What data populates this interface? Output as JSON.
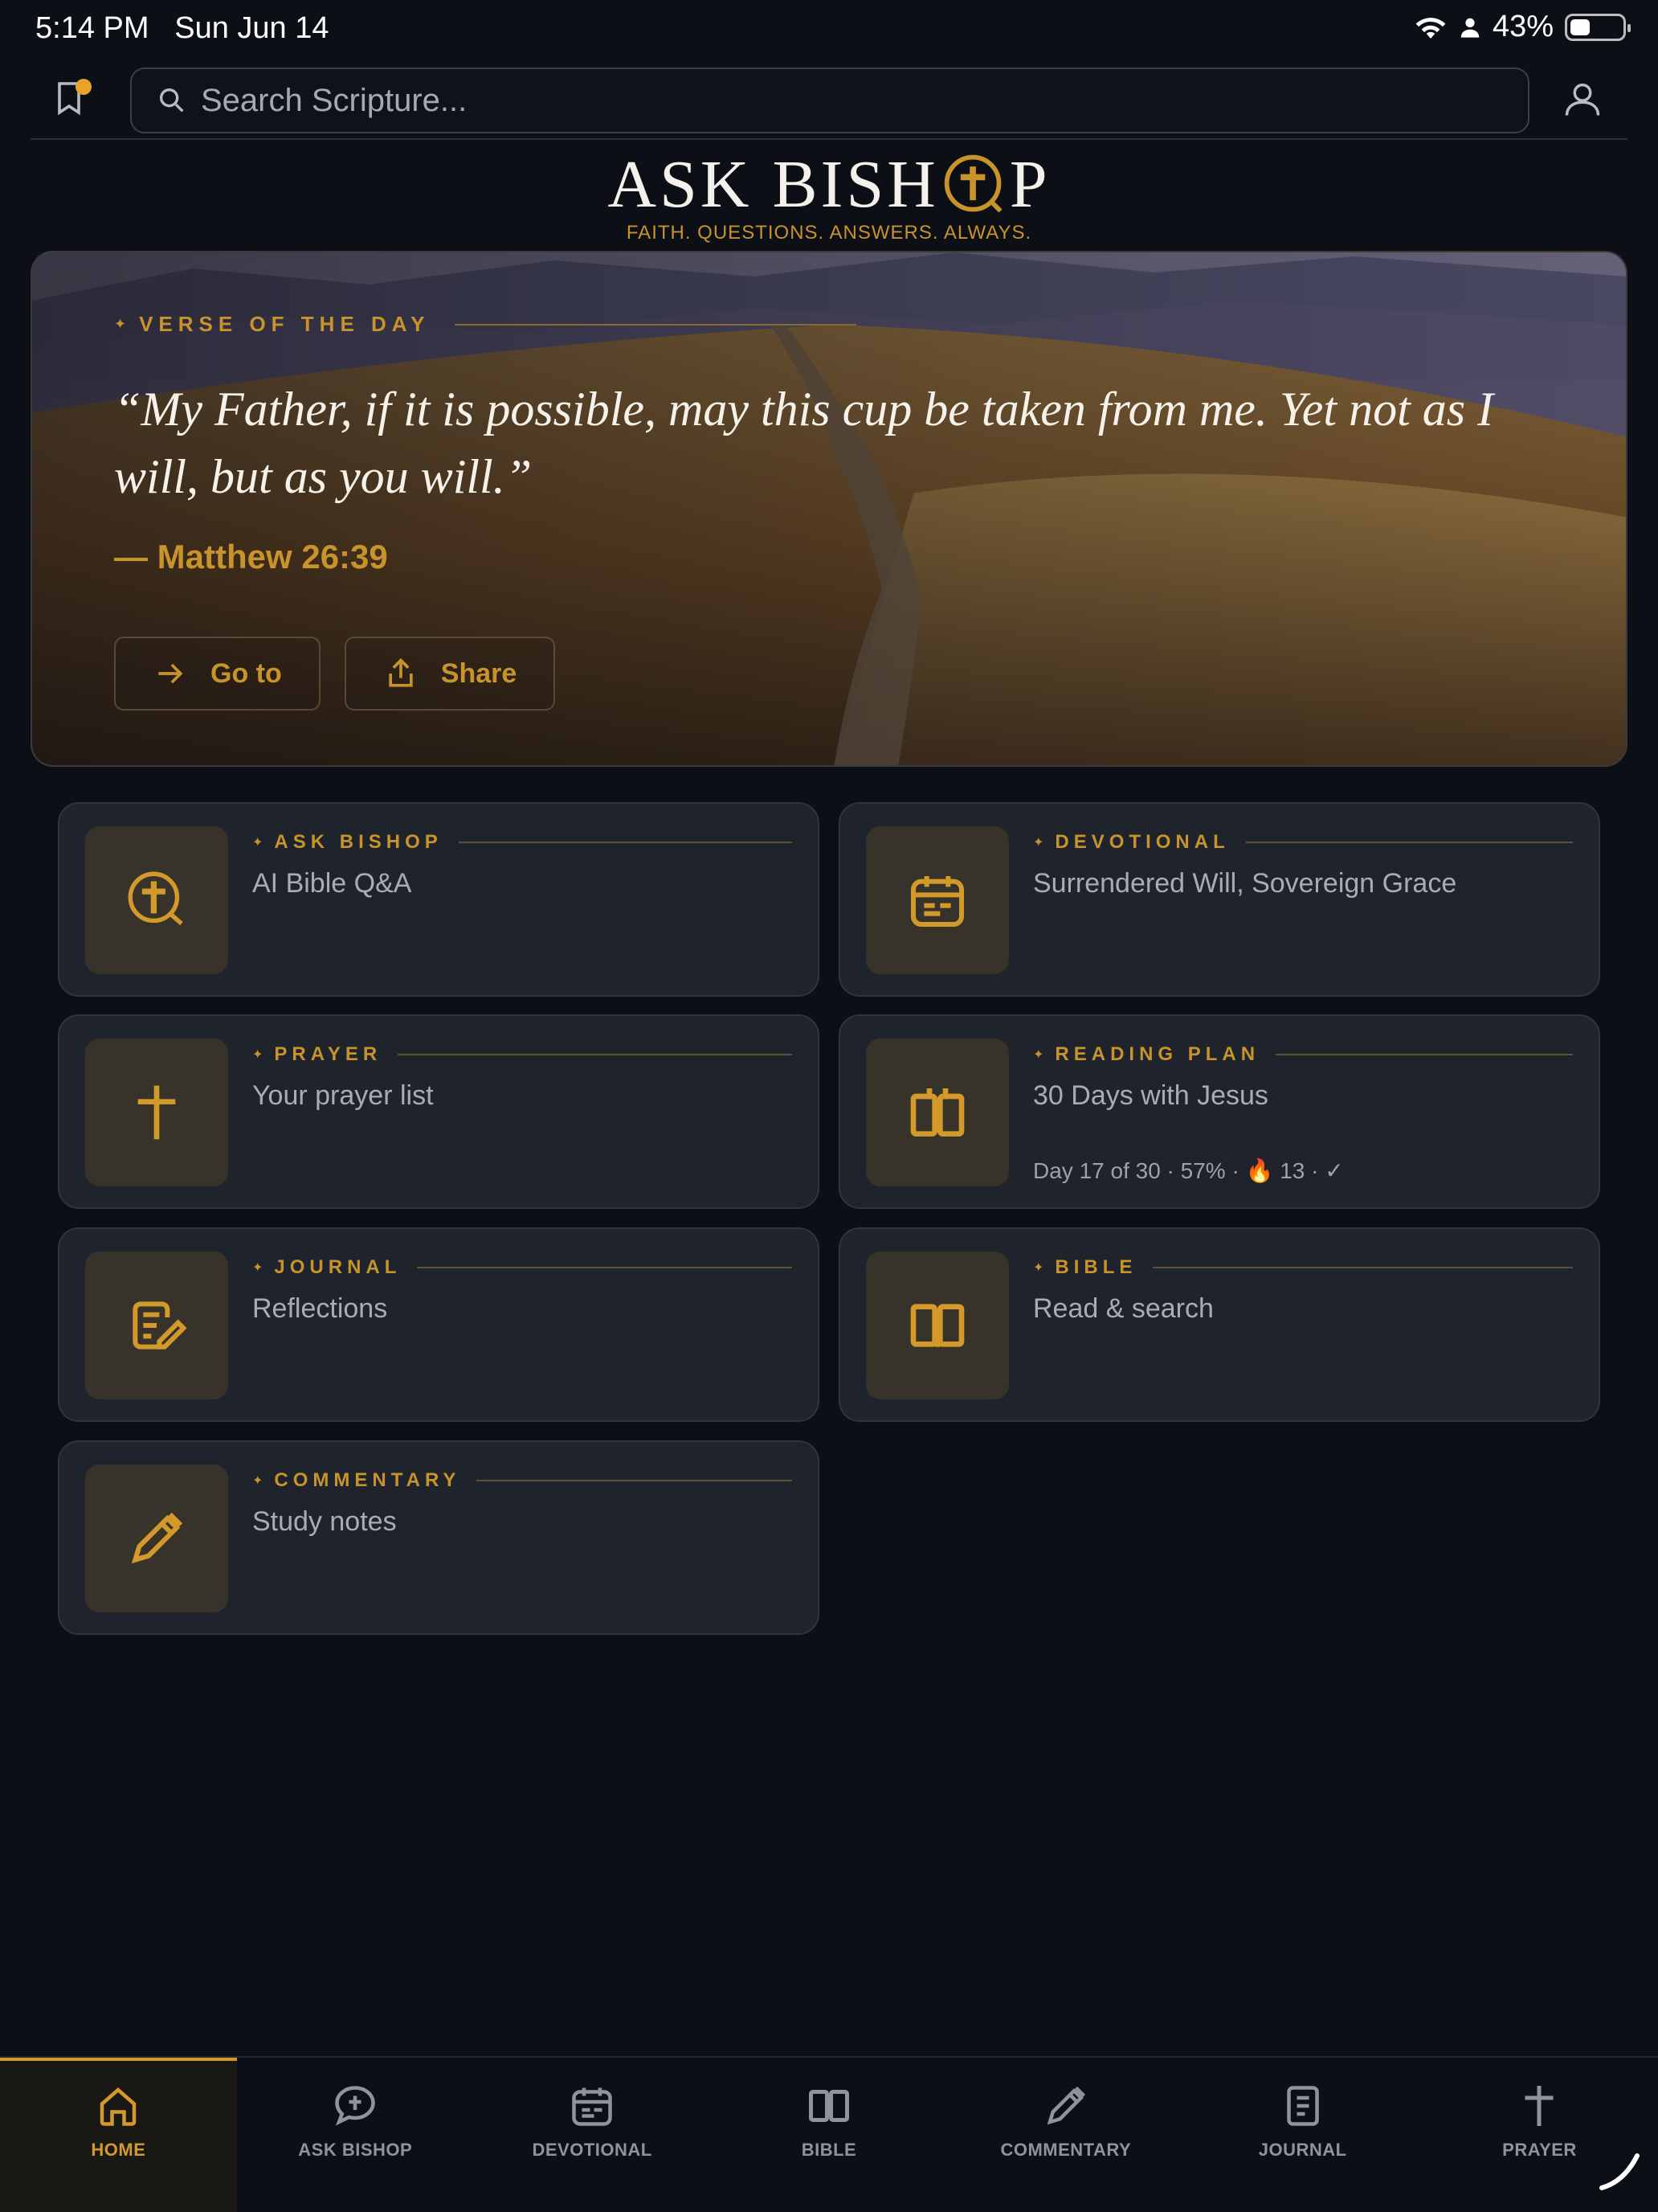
{
  "status": {
    "time": "5:14 PM",
    "date": "Sun Jun 14",
    "battery": "43%",
    "battery_level": 0.43
  },
  "search": {
    "placeholder": "Search Scripture..."
  },
  "logo": {
    "title_left": "ASK BISH",
    "title_right": "P",
    "tagline": "FAITH. QUESTIONS. ANSWERS. ALWAYS."
  },
  "hero": {
    "eyebrow": "VERSE OF THE DAY",
    "verse": "“My Father, if it is possible, may this cup be taken from me. Yet not as I will, but as you will.”",
    "reference": "— Matthew 26:39",
    "goto_label": "Go to",
    "share_label": "Share"
  },
  "cards": [
    {
      "title": "ASK BISHOP",
      "subtitle": "AI Bible Q&A",
      "icon": "cross-chat-icon"
    },
    {
      "title": "DEVOTIONAL",
      "subtitle": "Surrendered Will, Sovereign Grace",
      "icon": "calendar-icon"
    },
    {
      "title": "PRAYER",
      "subtitle": "Your prayer list",
      "icon": "cross-icon"
    },
    {
      "title": "READING PLAN",
      "subtitle": "30 Days with Jesus",
      "meta": "Day 17 of 30 · 57% · 🔥 13 · ✓",
      "icon": "book-icon"
    },
    {
      "title": "JOURNAL",
      "subtitle": "Reflections",
      "icon": "journal-edit-icon"
    },
    {
      "title": "BIBLE",
      "subtitle": "Read & search",
      "icon": "open-book-icon"
    },
    {
      "title": "COMMENTARY",
      "subtitle": "Study notes",
      "icon": "pen-icon"
    }
  ],
  "nav": [
    {
      "label": "HOME",
      "icon": "home-icon",
      "active": true
    },
    {
      "label": "ASK BISHOP",
      "icon": "chat-cross-icon"
    },
    {
      "label": "DEVOTIONAL",
      "icon": "calendar-icon"
    },
    {
      "label": "BIBLE",
      "icon": "book-icon"
    },
    {
      "label": "COMMENTARY",
      "icon": "pen-icon"
    },
    {
      "label": "JOURNAL",
      "icon": "document-icon"
    },
    {
      "label": "PRAYER",
      "icon": "cross-icon"
    }
  ],
  "colors": {
    "accent": "#c8932a",
    "background": "#0c0f16",
    "card": "#1f232c"
  }
}
